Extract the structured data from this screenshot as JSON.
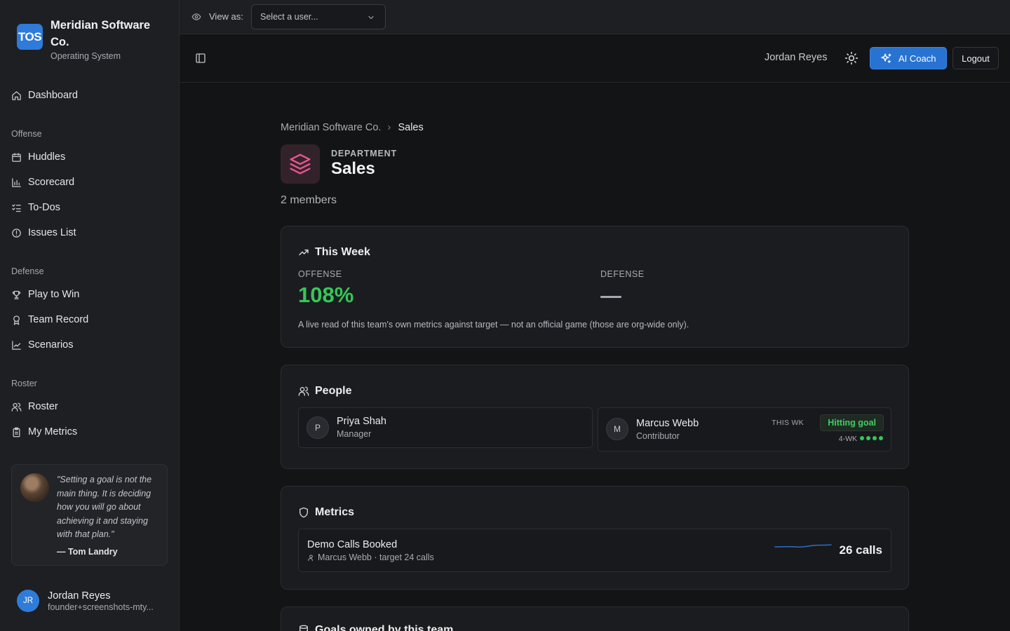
{
  "brand": {
    "logo": "TOS",
    "name": "Meridian Software Co.",
    "subtitle": "Operating System"
  },
  "nav": {
    "dashboard": "Dashboard",
    "offense_label": "Offense",
    "huddles": "Huddles",
    "scorecard": "Scorecard",
    "todos": "To-Dos",
    "issues": "Issues List",
    "defense_label": "Defense",
    "play_to_win": "Play to Win",
    "team_record": "Team Record",
    "scenarios": "Scenarios",
    "roster_label": "Roster",
    "roster": "Roster",
    "my_metrics": "My Metrics"
  },
  "quote": {
    "text": "\"Setting a goal is not the main thing. It is deciding how you will go about achieving it and staying with that plan.\"",
    "author": "— Tom Landry"
  },
  "sidebar_user": {
    "initials": "JR",
    "name": "Jordan Reyes",
    "email": "founder+screenshots-mty..."
  },
  "view_as": {
    "label": "View as:",
    "placeholder": "Select a user..."
  },
  "header": {
    "user": "Jordan Reyes",
    "coach_label": "AI Coach",
    "logout_label": "Logout"
  },
  "breadcrumb": {
    "org": "Meridian Software Co.",
    "current": "Sales"
  },
  "department": {
    "kicker": "DEPARTMENT",
    "title": "Sales",
    "members": "2 members"
  },
  "this_week": {
    "title": "This Week",
    "offense_label": "OFFENSE",
    "offense_value": "108%",
    "defense_label": "DEFENSE",
    "note": "A live read of this team's own metrics against target — not an official game (those are org-wide only)."
  },
  "people": {
    "title": "People",
    "members": [
      {
        "initial": "P",
        "name": "Priya Shah",
        "role": "Manager"
      },
      {
        "initial": "M",
        "name": "Marcus Webb",
        "role": "Contributor",
        "this_wk_label": "THIS WK",
        "status": "Hitting goal",
        "four_wk_label": "4-WK",
        "four_wk_hits": 4
      }
    ]
  },
  "metrics": {
    "title": "Metrics",
    "items": [
      {
        "name": "Demo Calls Booked",
        "owner_target": "Marcus Webb · target 24 calls",
        "value": "26 calls"
      }
    ]
  },
  "goals": {
    "title": "Goals owned by this team"
  },
  "colors": {
    "accent": "#2873d1",
    "success": "#34c759",
    "dept": "#e8558f"
  }
}
